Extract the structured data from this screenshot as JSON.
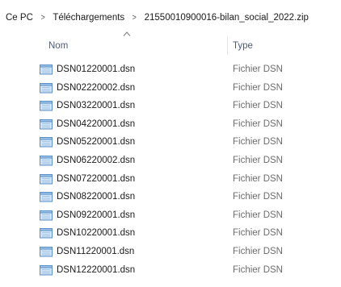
{
  "breadcrumb": {
    "items": [
      "Ce PC",
      "Téléchargements",
      "21550010900016-bilan_social_2022.zip"
    ],
    "separator": ">"
  },
  "columns": {
    "name": "Nom",
    "type": "Type",
    "sort_icon": "chevron-up-icon"
  },
  "files": [
    {
      "name": "DSN01220001.dsn",
      "type": "Fichier DSN"
    },
    {
      "name": "DSN02220002.dsn",
      "type": "Fichier DSN"
    },
    {
      "name": "DSN03220001.dsn",
      "type": "Fichier DSN"
    },
    {
      "name": "DSN04220001.dsn",
      "type": "Fichier DSN"
    },
    {
      "name": "DSN05220001.dsn",
      "type": "Fichier DSN"
    },
    {
      "name": "DSN06220002.dsn",
      "type": "Fichier DSN"
    },
    {
      "name": "DSN07220001.dsn",
      "type": "Fichier DSN"
    },
    {
      "name": "DSN08220001.dsn",
      "type": "Fichier DSN"
    },
    {
      "name": "DSN09220001.dsn",
      "type": "Fichier DSN"
    },
    {
      "name": "DSN10220001.dsn",
      "type": "Fichier DSN"
    },
    {
      "name": "DSN11220001.dsn",
      "type": "Fichier DSN"
    },
    {
      "name": "DSN12220001.dsn",
      "type": "Fichier DSN"
    }
  ],
  "colors": {
    "header_text": "#4a5a7a",
    "type_text": "#6d6d6d",
    "icon_fill": "#cfe4f7",
    "icon_stroke": "#5b8fc7"
  }
}
